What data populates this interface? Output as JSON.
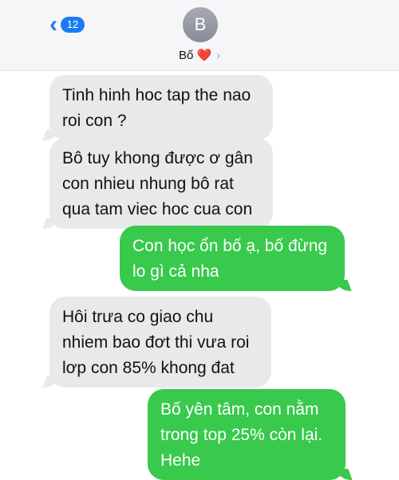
{
  "header": {
    "back_icon": "chevron-left-icon",
    "unread_count": "12",
    "avatar_initial": "B",
    "contact_name": "Bố",
    "heart": "❤️",
    "info_chevron": "›"
  },
  "messages": [
    {
      "direction": "incoming",
      "lines": [
        "Tinh hinh hoc tap the nao",
        "roi con ?"
      ]
    },
    {
      "direction": "incoming",
      "lines": [
        "Bô tuy khong được ơ gân",
        "con nhieu nhung bô rat",
        "qua tam viec hoc cua con"
      ]
    },
    {
      "direction": "outgoing",
      "lines": [
        "Con học ổn bố ạ, bố đừng",
        "lo gì cả nha"
      ]
    },
    {
      "direction": "incoming",
      "lines": [
        "Hôi trưa co giao chu",
        "nhiem bao đơt thi vưa roi",
        "lơp con 85% khong đat"
      ]
    },
    {
      "direction": "outgoing",
      "lines": [
        "Bố yên tâm, con nằm",
        "trong top 25% còn lại.",
        "Hehe"
      ]
    }
  ],
  "colors": {
    "incoming_bubble": "#e9e9eb",
    "outgoing_bubble": "#38c94d",
    "accent": "#1a7cf3"
  }
}
